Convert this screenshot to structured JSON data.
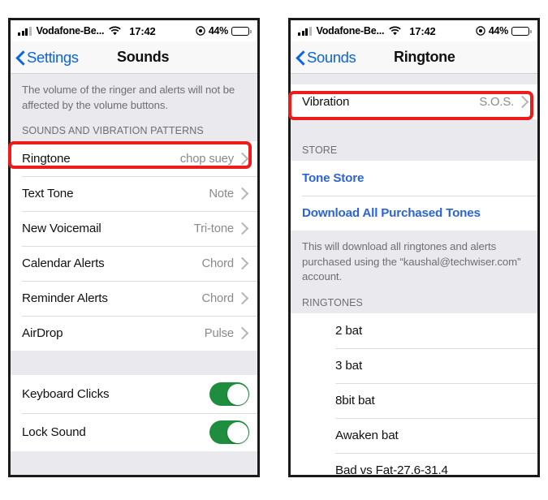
{
  "status_bar": {
    "carrier": "Vodafone-Be...",
    "time": "17:42",
    "battery_percent": "44%",
    "battery_level": 44,
    "icons": [
      "signal-bars-icon",
      "wifi-icon",
      "location-services-icon",
      "battery-icon"
    ]
  },
  "left_panel": {
    "nav": {
      "back_label": "Settings",
      "title": "Sounds"
    },
    "blurb": "The volume of the ringer and alerts will not be affected by the volume buttons.",
    "section_header": "SOUNDS AND VIBRATION PATTERNS",
    "rows": [
      {
        "label": "Ringtone",
        "value": "chop suey",
        "highlighted": true
      },
      {
        "label": "Text Tone",
        "value": "Note",
        "highlighted": false
      },
      {
        "label": "New Voicemail",
        "value": "Tri-tone",
        "highlighted": false
      },
      {
        "label": "Calendar Alerts",
        "value": "Chord",
        "highlighted": false
      },
      {
        "label": "Reminder Alerts",
        "value": "Chord",
        "highlighted": false
      },
      {
        "label": "AirDrop",
        "value": "Pulse",
        "highlighted": false
      }
    ],
    "toggles": [
      {
        "label": "Keyboard Clicks",
        "state": "on"
      },
      {
        "label": "Lock Sound",
        "state": "on"
      }
    ]
  },
  "right_panel": {
    "nav": {
      "back_label": "Sounds",
      "title": "Ringtone"
    },
    "vibration_row": {
      "label": "Vibration",
      "value": "S.O.S.",
      "highlighted": true
    },
    "store_header": "STORE",
    "store_links": [
      {
        "label": "Tone Store"
      },
      {
        "label": "Download All Purchased Tones"
      }
    ],
    "store_footer": "This will download all ringtones and alerts purchased using the “kaushal@techwiser.com” account.",
    "ringtones_header": "RINGTONES",
    "ringtones": [
      {
        "label": "2 bat"
      },
      {
        "label": "3 bat"
      },
      {
        "label": "8bit bat"
      },
      {
        "label": "Awaken bat"
      },
      {
        "label": "Bad vs Fat-27.6-31.4"
      }
    ]
  },
  "colors": {
    "accent_blue": "#0b64e0",
    "link_blue": "#2b63d9",
    "toggle_green": "#1e8e3e",
    "highlight_red": "#ee1b1b",
    "group_bg": "#e9e9ee",
    "secondary_text": "#8a8a8e"
  }
}
